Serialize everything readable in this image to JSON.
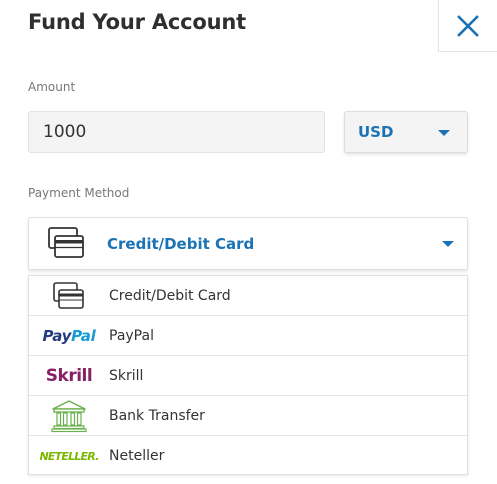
{
  "header": {
    "title": "Fund Your Account",
    "close_icon": "close-icon"
  },
  "amount": {
    "label": "Amount",
    "value": "1000"
  },
  "currency": {
    "selected": "USD",
    "icon": "chevron-down-icon"
  },
  "payment_method": {
    "label": "Payment Method",
    "selected": "Credit/Debit Card",
    "selected_icon": "credit-card-icon",
    "options": [
      {
        "label": "Credit/Debit Card",
        "icon": "credit-card-icon"
      },
      {
        "label": "PayPal",
        "logo_text_1": "Pay",
        "logo_text_2": "Pal"
      },
      {
        "label": "Skrill",
        "logo_text": "Skrill"
      },
      {
        "label": "Bank Transfer",
        "icon": "bank-icon"
      },
      {
        "label": "Neteller",
        "logo_text": "NETELLER."
      }
    ]
  },
  "colors": {
    "accent": "#1a73b5",
    "paypal_dark": "#253b80",
    "paypal_light": "#179bd7",
    "skrill": "#862165",
    "neteller": "#7ab800",
    "bank_green": "#6ab04c"
  }
}
